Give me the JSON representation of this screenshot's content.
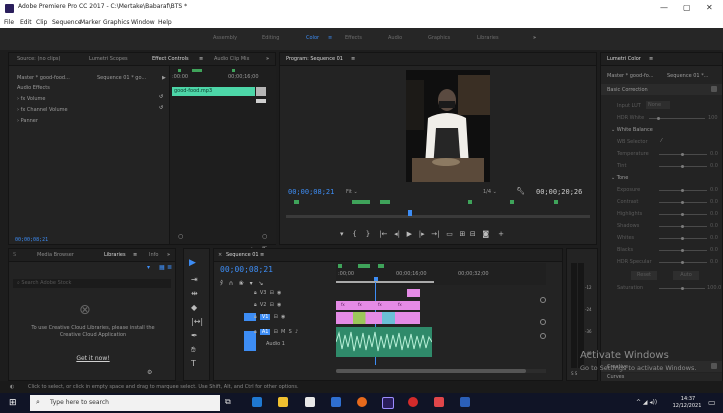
{
  "app": {
    "title": "Adobe Premiere Pro CC 2017 - C:\\Mertake\\Babaraf\\BTS *",
    "window_controls": [
      "—",
      "▢",
      "✕"
    ]
  },
  "menu": [
    "File",
    "Edit",
    "Clip",
    "Sequence",
    "Marker",
    "Graphics",
    "Window",
    "Help"
  ],
  "workspaces": {
    "items": [
      "Assembly",
      "Editing",
      "Color",
      "Effects",
      "Audio",
      "Graphics",
      "Libraries"
    ],
    "active": "Color",
    "more": "»"
  },
  "source_panel": {
    "tabs": [
      "Source: (no clips)",
      "Lumetri Scopes",
      "Effect Controls",
      "Audio Clip Mix"
    ],
    "more": "»",
    "master_label": "Master * good-food...",
    "sequence_label": "Sequence 01 * go...",
    "section": "Audio Effects",
    "effects": [
      "fx Volume",
      "fx Channel Volume",
      "Panner"
    ],
    "ruler_start": ":00:00",
    "ruler_mid": "00;00;16;00",
    "clip_name": "good-food.mp3",
    "timecode": "00;00;08;21"
  },
  "program": {
    "tab": "Program: Sequence 01",
    "timecode": "00;00;08;21",
    "fit": "Fit",
    "quality": "1/4",
    "duration": "00;00;20;26"
  },
  "lumetri": {
    "tab": "Lumetri Color",
    "master": "Master * good-fo...",
    "sequence": "Sequence 01 *...",
    "section": "Basic Correction",
    "input_lut_label": "Input LUT",
    "input_lut_value": "None",
    "hdr_white_label": "HDR White",
    "hdr_white_value": "100",
    "white_balance": "White Balance",
    "wb_selector": "WB Selector",
    "params_wb": [
      {
        "label": "Temperature",
        "value": "0.0"
      },
      {
        "label": "Tint",
        "value": "0.0"
      }
    ],
    "tone": "Tone",
    "params_tone": [
      {
        "label": "Exposure",
        "value": "0.0"
      },
      {
        "label": "Contrast",
        "value": "0.0"
      },
      {
        "label": "Highlights",
        "value": "0.0"
      },
      {
        "label": "Shadows",
        "value": "0.0"
      },
      {
        "label": "Whites",
        "value": "0.0"
      },
      {
        "label": "Blacks",
        "value": "0.0"
      },
      {
        "label": "HDR Specular",
        "value": "0.0"
      }
    ],
    "reset": "Reset",
    "auto": "Auto",
    "saturation_label": "Saturation",
    "saturation_value": "100.0",
    "creative": "Creative",
    "curves": "Curves"
  },
  "libraries_panel": {
    "tabs": [
      "Media Browser",
      "Libraries",
      "Info"
    ],
    "more": "»",
    "search_placeholder": "Search Adobe Stock",
    "message": "To use Creative Cloud Libraries, please install the Creative Cloud Application",
    "link": "Get it now!"
  },
  "timeline": {
    "tab": "Sequence 01",
    "timecode": "00;00;08;21",
    "ruler": [
      ":00;00",
      "00;00;16;00",
      "00;00;32;00"
    ],
    "tracks": [
      {
        "id": "V3",
        "kind": "video"
      },
      {
        "id": "V2",
        "kind": "video"
      },
      {
        "id": "V1",
        "kind": "video"
      },
      {
        "id": "A1",
        "kind": "audio",
        "name": "Audio 1"
      }
    ],
    "audio_buttons": [
      "M",
      "S"
    ],
    "meter_scale": [
      "-12",
      "-24",
      "-36",
      "-48"
    ],
    "meter_foot": "S S"
  },
  "status": {
    "hint": "Click to select, or click in empty space and drag to marquee select. Use Shift, Alt, and Ctrl for other options."
  },
  "watermark": {
    "line1": "Activate Windows",
    "line2": "Go to Settings to activate Windows."
  },
  "taskbar": {
    "search_placeholder": "Type here to search",
    "time": "14:37",
    "date": "12/12/2021"
  },
  "colors": {
    "accent": "#3d8df5",
    "clip_teal": "#4dd6a8",
    "clip_pink": "#e58be6",
    "audio_green": "#2f8a6a",
    "playhead": "#3d8df5"
  }
}
